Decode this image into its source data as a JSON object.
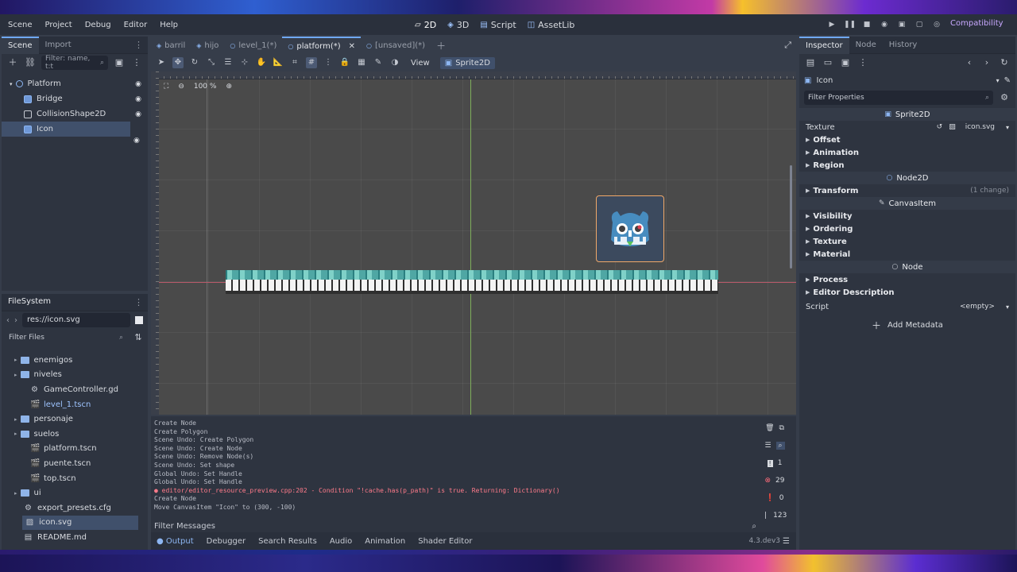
{
  "menubar": {
    "menus": [
      "Scene",
      "Project",
      "Debug",
      "Editor",
      "Help"
    ],
    "workspaces": [
      {
        "label": "2D",
        "icon": "2d-icon",
        "active": true
      },
      {
        "label": "3D",
        "icon": "3d-icon",
        "active": false
      },
      {
        "label": "Script",
        "icon": "script-icon",
        "active": false
      },
      {
        "label": "AssetLib",
        "icon": "assetlib-icon",
        "active": false
      }
    ],
    "renderer": "Compatibility"
  },
  "scene_dock": {
    "tabs": [
      "Scene",
      "Import"
    ],
    "filter_placeholder": "Filter: name, t:t",
    "tree": [
      {
        "label": "Platform",
        "icon": "node2d-icon",
        "indent": 0
      },
      {
        "label": "Bridge",
        "icon": "sprite-icon",
        "indent": 1
      },
      {
        "label": "CollisionShape2D",
        "icon": "collision-icon",
        "indent": 1
      },
      {
        "label": "Icon",
        "icon": "sprite-icon",
        "indent": 1,
        "selected": true
      }
    ]
  },
  "filesystem": {
    "title": "FileSystem",
    "path": "res://icon.svg",
    "filter_placeholder": "Filter Files",
    "items": [
      {
        "label": "enemigos",
        "type": "folder",
        "indent": 1
      },
      {
        "label": "niveles",
        "type": "folder",
        "indent": 1
      },
      {
        "label": "GameController.gd",
        "type": "gear",
        "indent": 2
      },
      {
        "label": "level_1.tscn",
        "type": "scene",
        "indent": 2
      },
      {
        "label": "personaje",
        "type": "folder",
        "indent": 1
      },
      {
        "label": "suelos",
        "type": "folder",
        "indent": 1
      },
      {
        "label": "platform.tscn",
        "type": "scene",
        "indent": 2
      },
      {
        "label": "puente.tscn",
        "type": "scene",
        "indent": 2
      },
      {
        "label": "top.tscn",
        "type": "scene",
        "indent": 2
      },
      {
        "label": "ui",
        "type": "folder",
        "indent": 1
      },
      {
        "label": "export_presets.cfg",
        "type": "gear",
        "indent": 1
      },
      {
        "label": "icon.svg",
        "type": "image",
        "indent": 1,
        "selected": true
      },
      {
        "label": "README.md",
        "type": "doc",
        "indent": 1
      }
    ]
  },
  "scene_tabs": [
    {
      "label": "barril",
      "active": false
    },
    {
      "label": "hijo",
      "active": false
    },
    {
      "label": "level_1(*)",
      "active": false
    },
    {
      "label": "platform(*)",
      "active": true
    },
    {
      "label": "[unsaved](*)",
      "active": false
    }
  ],
  "toolbar2d": {
    "view_label": "View",
    "sprite_label": "Sprite2D"
  },
  "viewport": {
    "zoom": "100 %"
  },
  "output": {
    "lines": [
      {
        "text": "Create Node",
        "error": false
      },
      {
        "text": "Create Polygon",
        "error": false
      },
      {
        "text": "Scene Undo: Create Polygon",
        "error": false
      },
      {
        "text": "Scene Undo: Create Node",
        "error": false
      },
      {
        "text": "Scene Undo: Remove Node(s)",
        "error": false
      },
      {
        "text": "Scene Undo: Set shape",
        "error": false
      },
      {
        "text": "Global Undo: Set Handle",
        "error": false
      },
      {
        "text": "Global Undo: Set Handle",
        "error": false
      },
      {
        "text": "editor/editor_resource_preview.cpp:202 - Condition \"!cache.has(p_path)\" is true. Returning: Dictionary()",
        "error": true
      },
      {
        "text": "Create Node",
        "error": false
      },
      {
        "text": "Move CanvasItem \"Icon\" to (300, -100)",
        "error": false
      }
    ],
    "counts": {
      "messages": "1",
      "errors": "29",
      "warnings": "0",
      "info": "123"
    },
    "filter_placeholder": "Filter Messages"
  },
  "bottom_tabs": [
    "Output",
    "Debugger",
    "Search Results",
    "Audio",
    "Animation",
    "Shader Editor"
  ],
  "version": "4.3.dev3",
  "inspector": {
    "tabs": [
      "Inspector",
      "Node",
      "History"
    ],
    "object_name": "Icon",
    "filter_placeholder": "Filter Properties",
    "class_sprite": "Sprite2D",
    "texture_label": "Texture",
    "texture_value": "icon.svg",
    "sprite_sections": [
      "Offset",
      "Animation",
      "Region"
    ],
    "class_node2d": "Node2D",
    "transform_label": "Transform",
    "transform_change": "(1 change)",
    "class_canvas": "CanvasItem",
    "canvas_sections": [
      "Visibility",
      "Ordering",
      "Texture",
      "Material"
    ],
    "class_node": "Node",
    "node_sections": [
      "Process",
      "Editor Description"
    ],
    "script_label": "Script",
    "script_value": "<empty>",
    "add_metadata": "Add Metadata"
  }
}
